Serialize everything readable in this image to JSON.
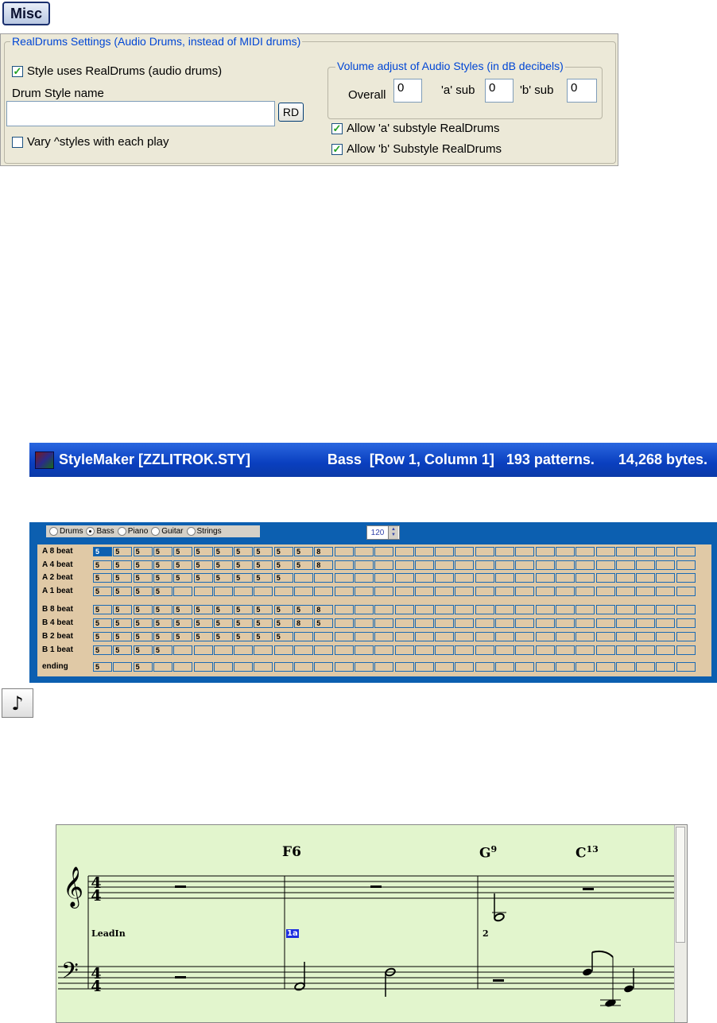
{
  "misc_button": {
    "label": "Misc"
  },
  "realdrums": {
    "group_title": "RealDrums Settings (Audio Drums, instead of MIDI drums)",
    "style_uses_realdrums": {
      "label": "Style uses RealDrums (audio drums)",
      "checked": true
    },
    "drum_style_name_label": "Drum Style name",
    "drum_style_name_value": "",
    "rd_button": "RD",
    "vary_styles": {
      "label": "Vary ^styles with each play",
      "checked": false
    },
    "volume_group_title": "Volume adjust of Audio Styles (in dB decibels)",
    "overall_label": "Overall",
    "overall_value": "0",
    "a_sub_label": "'a' sub",
    "a_sub_value": "0",
    "b_sub_label": "'b' sub",
    "b_sub_value": "0",
    "allow_a": {
      "label": "Allow 'a' substyle RealDrums",
      "checked": true
    },
    "allow_b": {
      "label": "Allow 'b' Substyle RealDrums",
      "checked": true
    }
  },
  "stylemaker_titlebar": {
    "title": "StyleMaker [ZZLITROK.STY]",
    "status": "Bass  [Row 1, Column 1]   193 patterns.      14,268 bytes."
  },
  "pattern_grid": {
    "instruments": [
      {
        "label": "Drums",
        "selected": false
      },
      {
        "label": "Bass",
        "selected": true
      },
      {
        "label": "Piano",
        "selected": false
      },
      {
        "label": "Guitar",
        "selected": false
      },
      {
        "label": "Strings",
        "selected": false
      }
    ],
    "tempo": "120",
    "columns": 30,
    "rows": [
      {
        "label": "A 8 beat",
        "cells": [
          "5",
          "5",
          "5",
          "5",
          "5",
          "5",
          "5",
          "5",
          "5",
          "5",
          "5",
          "8"
        ]
      },
      {
        "label": "A 4 beat",
        "cells": [
          "5",
          "5",
          "5",
          "5",
          "5",
          "5",
          "5",
          "5",
          "5",
          "5",
          "5",
          "8"
        ]
      },
      {
        "label": "A 2 beat",
        "cells": [
          "5",
          "5",
          "5",
          "5",
          "5",
          "5",
          "5",
          "5",
          "5",
          "5"
        ]
      },
      {
        "label": "A 1 beat",
        "cells": [
          "5",
          "5",
          "5",
          "5"
        ]
      },
      {
        "label": "B 8 beat",
        "cells": [
          "5",
          "5",
          "5",
          "5",
          "5",
          "5",
          "5",
          "5",
          "5",
          "5",
          "5",
          "8"
        ]
      },
      {
        "label": "B 4 beat",
        "cells": [
          "5",
          "5",
          "5",
          "5",
          "5",
          "5",
          "5",
          "5",
          "5",
          "5",
          "8",
          "5"
        ]
      },
      {
        "label": "B 2 beat",
        "cells": [
          "5",
          "5",
          "5",
          "5",
          "5",
          "5",
          "5",
          "5",
          "5",
          "5"
        ]
      },
      {
        "label": "B 1 beat",
        "cells": [
          "5",
          "5",
          "5",
          "5"
        ]
      },
      {
        "label": "ending",
        "cells": [
          "5",
          "",
          "5"
        ]
      }
    ]
  },
  "note_button": {
    "icon": "eighth-note-icon",
    "glyph": "♪"
  },
  "notation": {
    "chords": [
      {
        "root": "F",
        "ext": "6"
      },
      {
        "root": "G",
        "ext": "9"
      },
      {
        "root": "C",
        "ext": "13"
      }
    ],
    "time_signature": [
      "4",
      "4"
    ],
    "annotations": {
      "leadin": "LeadIn",
      "section": "1a",
      "bar_number": "2"
    }
  }
}
